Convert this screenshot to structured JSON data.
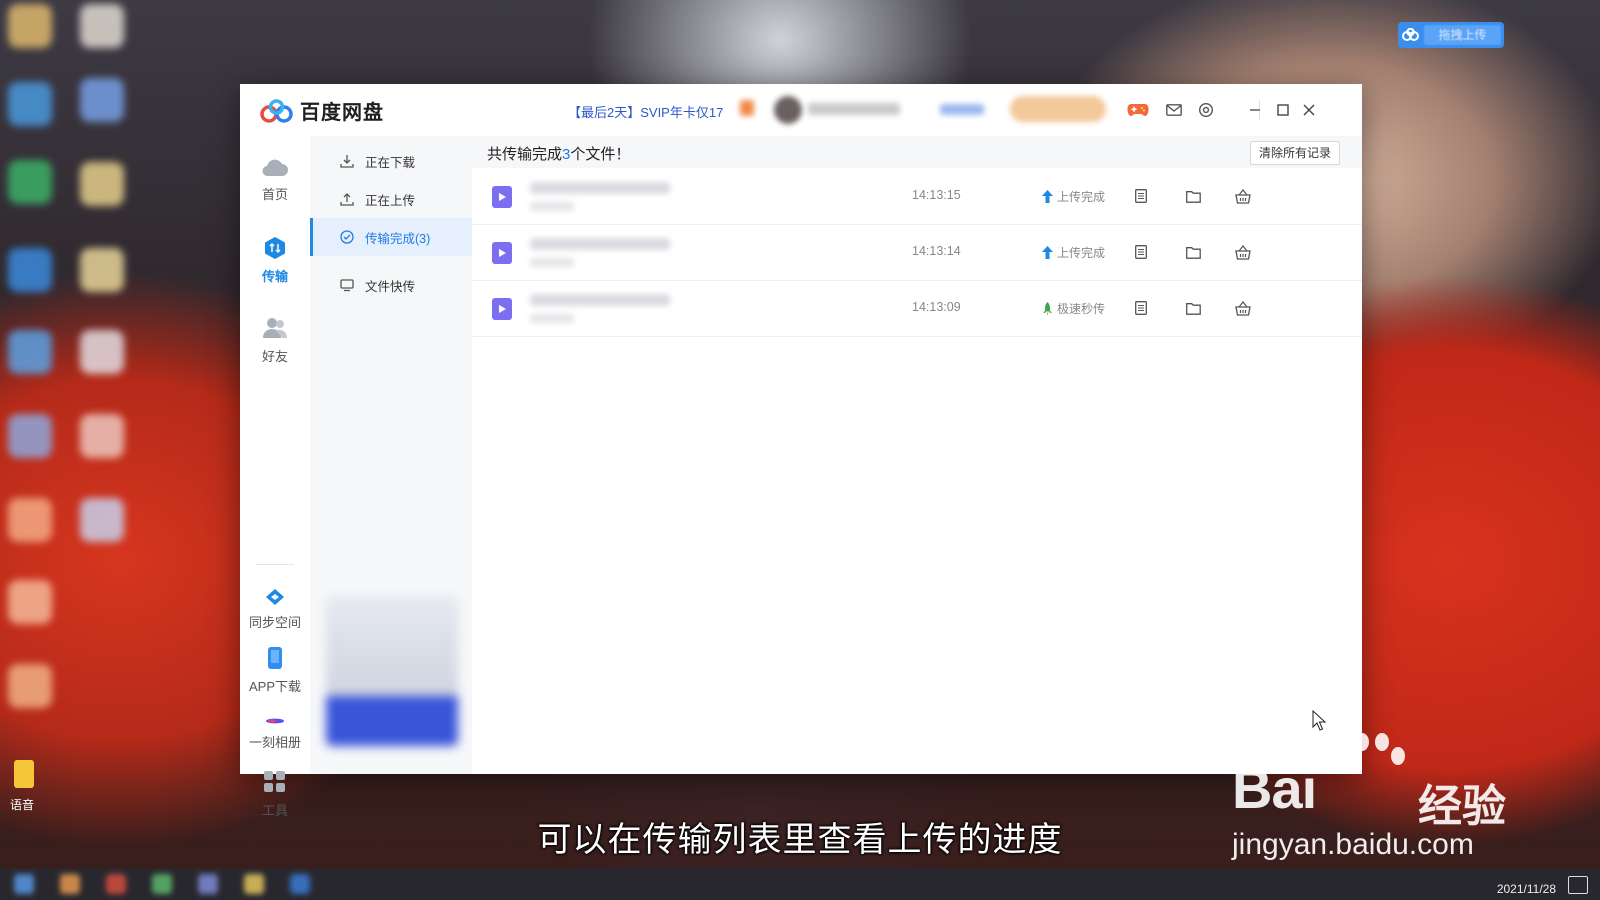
{
  "desktop": {
    "icon_label_yy": "语音",
    "drag_upload_label": "拖拽上传"
  },
  "app": {
    "title": "百度网盘",
    "promo_text": "【最后2天】SVIP年卡仅17"
  },
  "leftnav": {
    "items": [
      {
        "label": "首页",
        "icon": "cloud-icon"
      },
      {
        "label": "传输",
        "icon": "transfer-icon"
      },
      {
        "label": "好友",
        "icon": "friends-icon"
      },
      {
        "label": "同步空间",
        "icon": "sync-icon"
      },
      {
        "label": "APP下载",
        "icon": "phone-icon"
      },
      {
        "label": "一刻相册",
        "icon": "album-icon"
      },
      {
        "label": "工具",
        "icon": "tools-icon"
      }
    ]
  },
  "subnav": {
    "items": [
      {
        "label": "正在下载",
        "icon": "download-icon"
      },
      {
        "label": "正在上传",
        "icon": "upload-icon"
      },
      {
        "label": "传输完成(3)",
        "icon": "check-circle-icon"
      },
      {
        "label": "文件快传",
        "icon": "monitor-icon"
      }
    ]
  },
  "main": {
    "summary_prefix": "共传输完成",
    "summary_count": "3",
    "summary_suffix": "个文件！",
    "clear_button": "清除所有记录",
    "rows": [
      {
        "time": "14:13:15",
        "status": "上传完成",
        "status_icon": "arrow-up-icon"
      },
      {
        "time": "14:13:14",
        "status": "上传完成",
        "status_icon": "arrow-up-icon"
      },
      {
        "time": "14:13:09",
        "status": "极速秒传",
        "status_icon": "rocket-icon"
      }
    ]
  },
  "overlay": {
    "subtitle": "可以在传输列表里查看上传的进度",
    "watermark_brand": "Bai",
    "watermark_cn": "经验",
    "watermark_url": "jingyan.baidu.com"
  },
  "taskbar": {
    "date": "2021/11/28"
  },
  "colors": {
    "accent": "#1e88e5",
    "promo": "#2e58c8",
    "file_icon": "#7b6ef0",
    "upload_status": "#1e88e5",
    "rocket_status": "#3aa84a"
  }
}
